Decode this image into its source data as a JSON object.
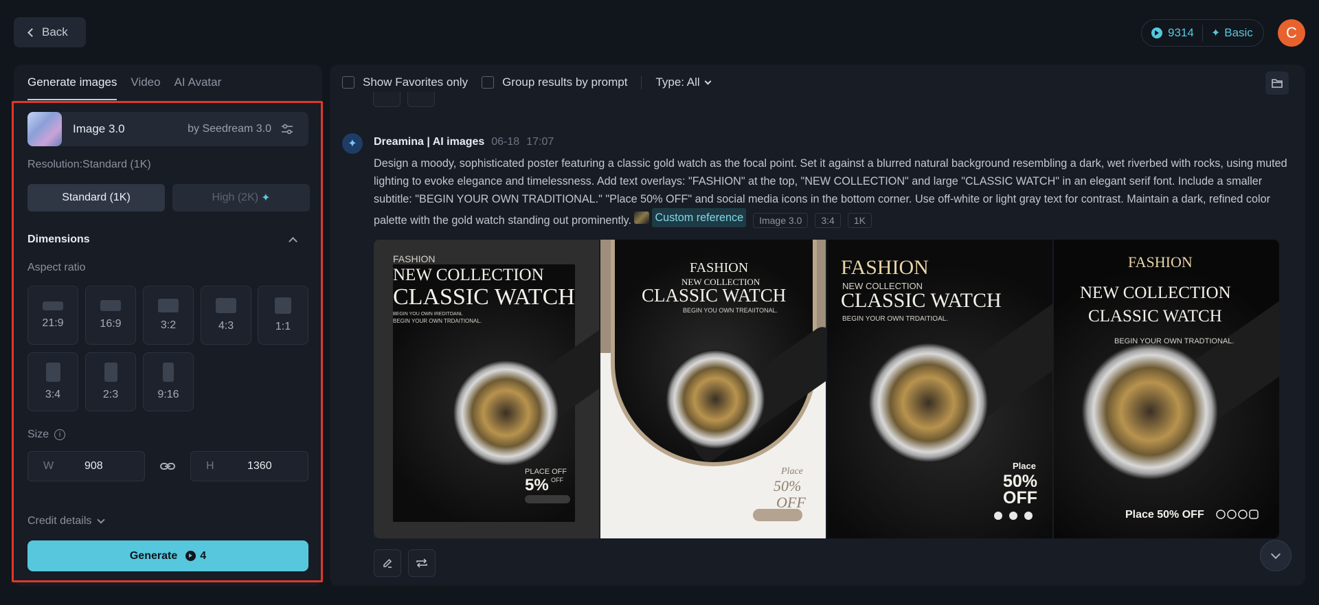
{
  "header": {
    "back_label": "Back",
    "credits": "9314",
    "plan": "Basic",
    "avatar_initial": "C"
  },
  "left_panel": {
    "tabs": [
      {
        "label": "Generate images",
        "active": true
      },
      {
        "label": "Video",
        "active": false
      },
      {
        "label": "AI Avatar",
        "active": false
      }
    ],
    "model": {
      "name": "Image 3.0",
      "by": "by Seedream 3.0"
    },
    "resolution_label": "Resolution:Standard (1K)",
    "resolution_options": [
      {
        "label": "Standard (1K)",
        "selected": true
      },
      {
        "label": "High (2K)",
        "selected": false
      }
    ],
    "dimensions_title": "Dimensions",
    "aspect_ratio_label": "Aspect ratio",
    "aspect_ratios": [
      "21:9",
      "16:9",
      "3:2",
      "4:3",
      "1:1",
      "3:4",
      "2:3",
      "9:16"
    ],
    "size_label": "Size",
    "width": {
      "prefix": "W",
      "value": "908"
    },
    "height": {
      "prefix": "H",
      "value": "1360"
    },
    "credit_details_label": "Credit details",
    "generate_label": "Generate",
    "generate_cost": "4"
  },
  "results": {
    "filters": {
      "favorites_label": "Show Favorites only",
      "group_label": "Group results by prompt",
      "type_label": "Type: All"
    },
    "message": {
      "sender": "Dreamina | AI images",
      "date": "06-18",
      "time": "17:07",
      "prompt": "Design a moody, sophisticated poster featuring a classic gold watch as the focal point. Set it against a blurred natural background resembling a dark, wet riverbed with rocks, using muted lighting to evoke elegance and timelessness. Add text overlays: \"FASHION\" at the top, \"NEW COLLECTION\" and large \"CLASSIC WATCH\" in an elegant serif font. Include a smaller subtitle: \"BEGIN YOUR OWN TRADITIONAL.\" \"Place 50% OFF\" and social media icons in the bottom corner. Use off-white or light gray text for contrast. Maintain a dark, refined color palette with the gold watch standing out prominently.",
      "reference_label": "Custom reference",
      "tags": [
        "Image 3.0",
        "3:4",
        "1K"
      ]
    },
    "posters": [
      {
        "fashion": "FASHION",
        "new_collection": "NEW COLLECTION",
        "classic_watch": "CLASSIC WATCH",
        "sub1": "BEGIN YOU OWN IREDITOANL",
        "sub2": "BEGIN YOUR OWN TRDAITIONAL.",
        "place": "PLACE OFF",
        "discount": "5%",
        "off": "OFF"
      },
      {
        "fashion": "FASHION",
        "new_collection": "NEW COLLECTION",
        "classic_watch": "CLASSIC WATCH",
        "sub1": "BEGIN YOU OWN TREAIITONAL.",
        "place": "Place",
        "discount": "50%",
        "off": "OFF"
      },
      {
        "fashion": "FASHION",
        "new_collection": "NEW COLLECTION",
        "classic_watch": "CLASSIC WATCH",
        "sub1": "BEGIN YOUR OWN TRDAITIOAL.",
        "place": "Place",
        "discount": "50%",
        "off": "OFF"
      },
      {
        "fashion": "FASHION",
        "new_collection": "NEW COLLECTION",
        "classic_watch": "CLASSIC WATCH",
        "sub1": "BEGIN YOUR OWN TRADTIONAL.",
        "place": "Place 50% OFF"
      }
    ]
  }
}
